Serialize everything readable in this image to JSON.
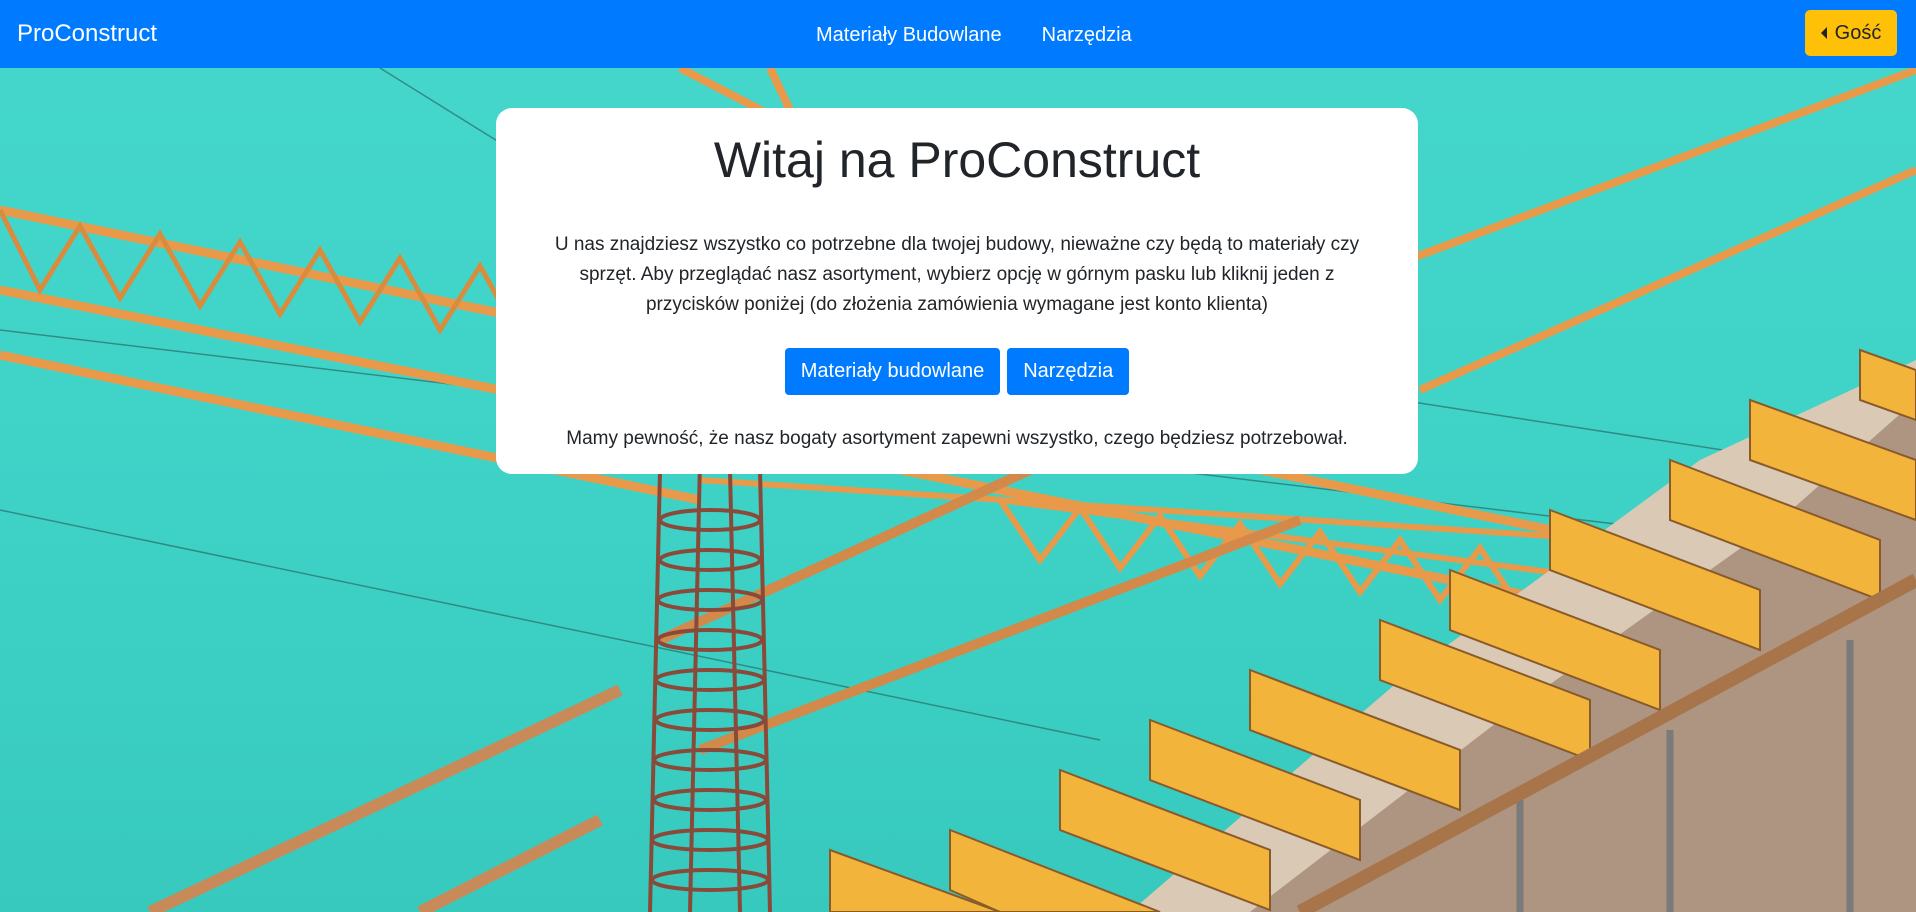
{
  "navbar": {
    "brand": "ProConstruct",
    "links": [
      "Materiały Budowlane",
      "Narzędzia"
    ],
    "user_button": "Gość"
  },
  "card": {
    "title": "Witaj na ProConstruct",
    "intro": "U nas znajdziesz wszystko co potrzebne dla twojej budowy, nieważne czy będą to materiały czy sprzęt. Aby przeglądać nasz asortyment, wybierz opcję w górnym pasku lub kliknij jeden z przycisków poniżej (do złożenia zamówienia wymagane jest konto klienta)",
    "buttons": [
      "Materiały budowlane",
      "Narzędzia"
    ],
    "outro": "Mamy pewność, że nasz bogaty asortyment zapewni wszystko, czego będziesz potrzebował."
  },
  "colors": {
    "primary": "#007bff",
    "warning": "#ffc107",
    "sky": "#3fd3c8",
    "crane": "#e89a4a",
    "beam": "#f2b43a"
  },
  "icons": {
    "user_button_icon": "caret-left-icon"
  }
}
